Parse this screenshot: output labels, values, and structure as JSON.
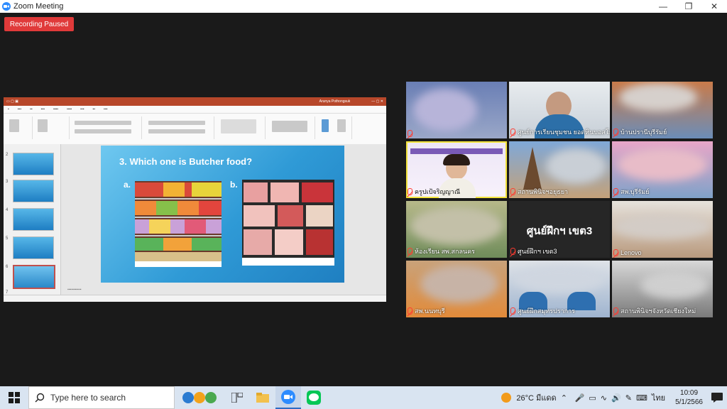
{
  "window": {
    "title": "Zoom Meeting"
  },
  "recording": {
    "label": "Recording Paused"
  },
  "ppt": {
    "user": "Arunya Pothongsuk",
    "slide": {
      "question": "3. Which one is  Butcher food?",
      "option_a": "a.",
      "option_b": "b."
    },
    "thumbnails": [
      "2",
      "3",
      "4",
      "5",
      "6",
      "7"
    ],
    "selected_thumbnail": "6"
  },
  "participants": [
    {
      "name": ""
    },
    {
      "name": "ศูนย์การเรียนชุมชน ยอดหินบอสโก"
    },
    {
      "name": "บ้านปรานีบุรีรัมย์"
    },
    {
      "name": "ครูปเป้จริญญาณี"
    },
    {
      "name": "สถานพินิจฯอยุธยา"
    },
    {
      "name": "สพ.บุรีรัมย์"
    },
    {
      "name": "ห้องเรียน สพ.สกลนคร"
    },
    {
      "name": "ศูนย์ฝึกฯ เขต3",
      "display_text": "ศูนย์ฝึกฯ เขต3"
    },
    {
      "name": "Lenovo"
    },
    {
      "name": "สพ.นนทบุรี"
    },
    {
      "name": "ศูนย์ฝึกสมุทรปราการ"
    },
    {
      "name": "สถานพินิจฯจังหวัดเชียงใหม่"
    }
  ],
  "taskbar": {
    "search_placeholder": "Type here to search",
    "weather": "26°C  มีแดด",
    "language": "ไทย",
    "time": "10:09",
    "date": "5/1/2566"
  },
  "colors": {
    "recording": "#e03a3a",
    "zoom_blue": "#2d8cff",
    "active_border": "#f2e33b",
    "ppt_red": "#b7472a"
  }
}
